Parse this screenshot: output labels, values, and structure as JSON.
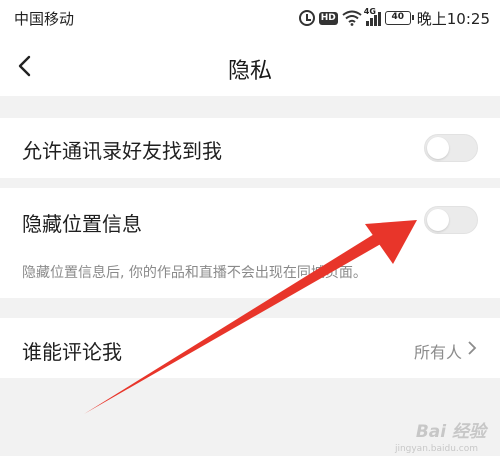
{
  "status_bar": {
    "carrier": "中国移动",
    "hd": "HD",
    "network": "4G",
    "battery": "40",
    "time": "晚上10:25",
    "icons": [
      "alarm-icon",
      "hd-icon",
      "wifi-icon",
      "signal-icon",
      "battery-icon"
    ]
  },
  "header": {
    "title": "隐私",
    "back_icon": "chevron-left-icon"
  },
  "settings": {
    "allow_contacts_find": {
      "label": "允许通讯录好友找到我",
      "enabled": false
    },
    "hide_location": {
      "label": "隐藏位置信息",
      "enabled": false,
      "description": "隐藏位置信息后, 你的作品和直播不会出现在同城页面。"
    },
    "who_can_comment": {
      "label": "谁能评论我",
      "value": "所有人"
    }
  },
  "annotation": {
    "arrow_color": "#e8352a"
  },
  "watermark": {
    "text": "Bai 经验",
    "sub": "jingyan.baidu.com"
  },
  "colors": {
    "background": "#f2f2f2",
    "toggle_off": "#ebebeb",
    "secondary_text": "#8a8a8a"
  }
}
